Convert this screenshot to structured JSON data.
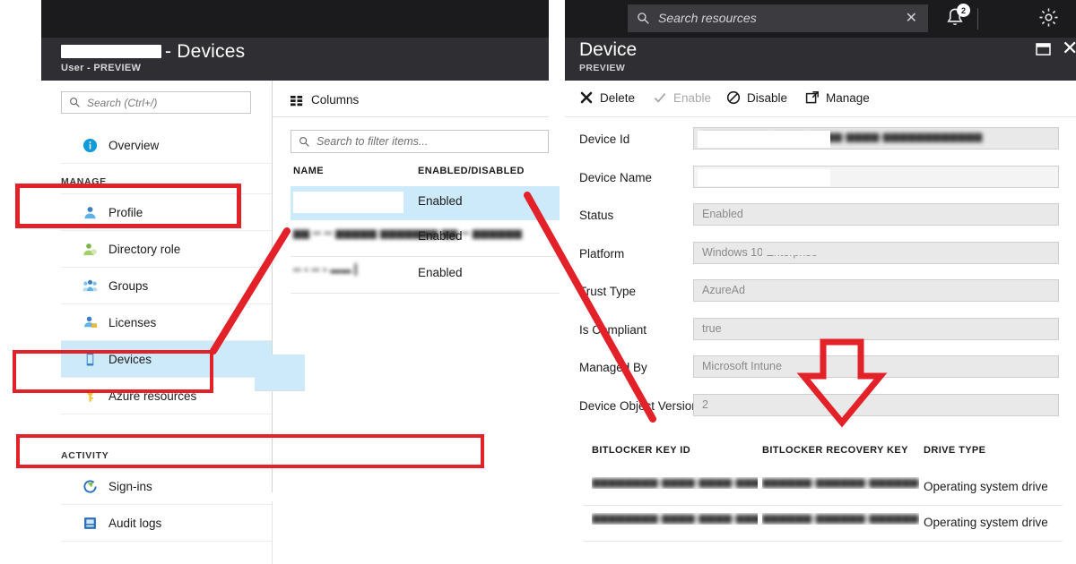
{
  "left_blade": {
    "title_redacted": true,
    "title_suffix": "- Devices",
    "subtitle": "User - PREVIEW",
    "nav_search_placeholder": "Search (Ctrl+/)",
    "nav": [
      {
        "label": "Overview",
        "icon": "info-icon",
        "type": "item",
        "selected": false
      },
      {
        "label": "MANAGE",
        "type": "section"
      },
      {
        "label": "Profile",
        "icon": "profile-icon",
        "type": "item",
        "selected": false
      },
      {
        "label": "Directory role",
        "icon": "directory-role-icon",
        "type": "item",
        "selected": false
      },
      {
        "label": "Groups",
        "icon": "groups-icon",
        "type": "item",
        "selected": false
      },
      {
        "label": "Licenses",
        "icon": "licenses-icon",
        "type": "item",
        "selected": false
      },
      {
        "label": "Devices",
        "icon": "device-icon",
        "type": "item",
        "selected": true
      },
      {
        "label": "Azure resources",
        "icon": "key-icon",
        "type": "item",
        "selected": false
      },
      {
        "label": "ACTIVITY",
        "type": "section"
      },
      {
        "label": "Sign-ins",
        "icon": "signin-icon",
        "type": "item",
        "selected": false
      },
      {
        "label": "Audit logs",
        "icon": "audit-log-icon",
        "type": "item",
        "selected": false
      }
    ]
  },
  "device_list": {
    "columns_button": "Columns",
    "filter_placeholder": "Search to filter items...",
    "headers": {
      "name": "NAME",
      "status": "ENABLED/DISABLED"
    },
    "rows": [
      {
        "name": "",
        "name_redacted": true,
        "status": "Enabled",
        "selected": true
      },
      {
        "name": "▆▆ ▪▪ ▪▪ ▆▆▆▆▆\n▆▆▆▆▆▆▆ ▆▆ ▪▪ ▆▆▆▆▆▆",
        "name_blurred": true,
        "status": "Enabled",
        "selected": false
      },
      {
        "name": "▪▪ ▪ ▪▪ ▪ ▬▬  ▎",
        "name_blurred": true,
        "status": "Enabled",
        "selected": false
      }
    ]
  },
  "top_bar": {
    "search_placeholder": "Search resources",
    "clear_icon": "close-icon",
    "notification_count": "2",
    "bell_icon": "bell-icon",
    "gear_icon": "gear-icon"
  },
  "right_blade": {
    "title": "Device",
    "subtitle": "PREVIEW",
    "restore_icon": "restore-window-icon",
    "close_icon": "close-icon",
    "commands": [
      {
        "label": "Delete",
        "icon": "delete-x-icon",
        "disabled": false
      },
      {
        "label": "Enable",
        "icon": "check-icon",
        "disabled": true
      },
      {
        "label": "Disable",
        "icon": "block-circle-icon",
        "disabled": false
      },
      {
        "label": "Manage",
        "icon": "external-link-icon",
        "disabled": false
      }
    ],
    "fields": [
      {
        "label": "Device Id",
        "value": "▆▆▆▆▆▆▆▆-▆▆▆▆-▆▆▆▆-▆▆▆▆-▆▆▆▆▆▆▆▆▆▆▆▆",
        "blurred": true,
        "masked": true
      },
      {
        "label": "Device Name",
        "value": "",
        "redacted": true
      },
      {
        "label": "Status",
        "value": "Enabled",
        "blurred": false
      },
      {
        "label": "Platform",
        "value": "Windows 10 Enterprise",
        "blurred": false,
        "partial_mask": true
      },
      {
        "label": "Trust Type",
        "value": "AzureAd",
        "blurred": false
      },
      {
        "label": "Is Compliant",
        "value": "true",
        "blurred": false
      },
      {
        "label": "Managed By",
        "value": "Microsoft Intune",
        "blurred": false
      },
      {
        "label": "Device Object Version",
        "value": "2",
        "blurred": false
      }
    ],
    "bitlocker": {
      "headers": [
        "BITLOCKER KEY ID",
        "BITLOCKER RECOVERY KEY",
        "DRIVE TYPE"
      ],
      "rows": [
        {
          "key_id": "▆▆▆▆▆▆▆▆-▆▆▆▆-▆▆▆▆-▆▆▆▆-▆▆▆",
          "recovery_key": "▆▆▆▆▆▆-▆▆▆▆▆▆-▆▆▆▆▆▆-▆▆36…",
          "drive_type": "Operating system drive"
        },
        {
          "key_id": "▆▆▆▆▆▆▆▆-▆▆▆▆-▆▆▆▆-▆▆▆▆-▆▆▆",
          "recovery_key": "▆▆▆▆▆▆-▆▆▆▆▆▆-▆▆▆▆▆▆-▆▆▆▆…",
          "drive_type": "Operating system drive"
        }
      ]
    }
  },
  "annotations": {
    "accent_color": "#e32129",
    "highlight_color": "#cdeafa",
    "callouts": [
      {
        "name": "devices-nav-highlight",
        "shape": "rect"
      },
      {
        "name": "selected-device-row-highlight",
        "shape": "rect"
      },
      {
        "name": "bitlocker-header-highlight",
        "shape": "rect"
      },
      {
        "name": "nav-to-row-arrow",
        "shape": "line"
      },
      {
        "name": "row-to-detail-arrow",
        "shape": "line"
      },
      {
        "name": "down-arrow-to-bitlocker",
        "shape": "arrow-down"
      }
    ]
  }
}
